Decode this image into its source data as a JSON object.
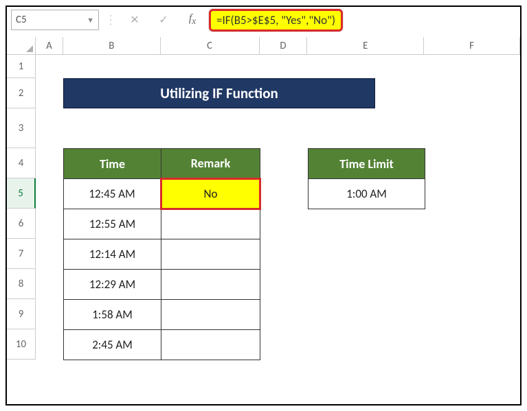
{
  "nameBox": "C5",
  "formula": "=IF(B5>$E$5, \"Yes\",\"No\")",
  "columns": [
    "A",
    "B",
    "C",
    "D",
    "E",
    "F"
  ],
  "rows": [
    "1",
    "2",
    "3",
    "4",
    "5",
    "6",
    "7",
    "8",
    "9",
    "10"
  ],
  "title": "Utilizing IF Function",
  "headers": {
    "time": "Time",
    "remark": "Remark",
    "timeLimit": "Time Limit"
  },
  "timeValues": [
    "12:45 AM",
    "12:55 AM",
    "12:14 AM",
    "12:29 AM",
    "1:58 AM",
    "2:45 AM"
  ],
  "remarkValue": "No",
  "timeLimit": "1:00 AM"
}
